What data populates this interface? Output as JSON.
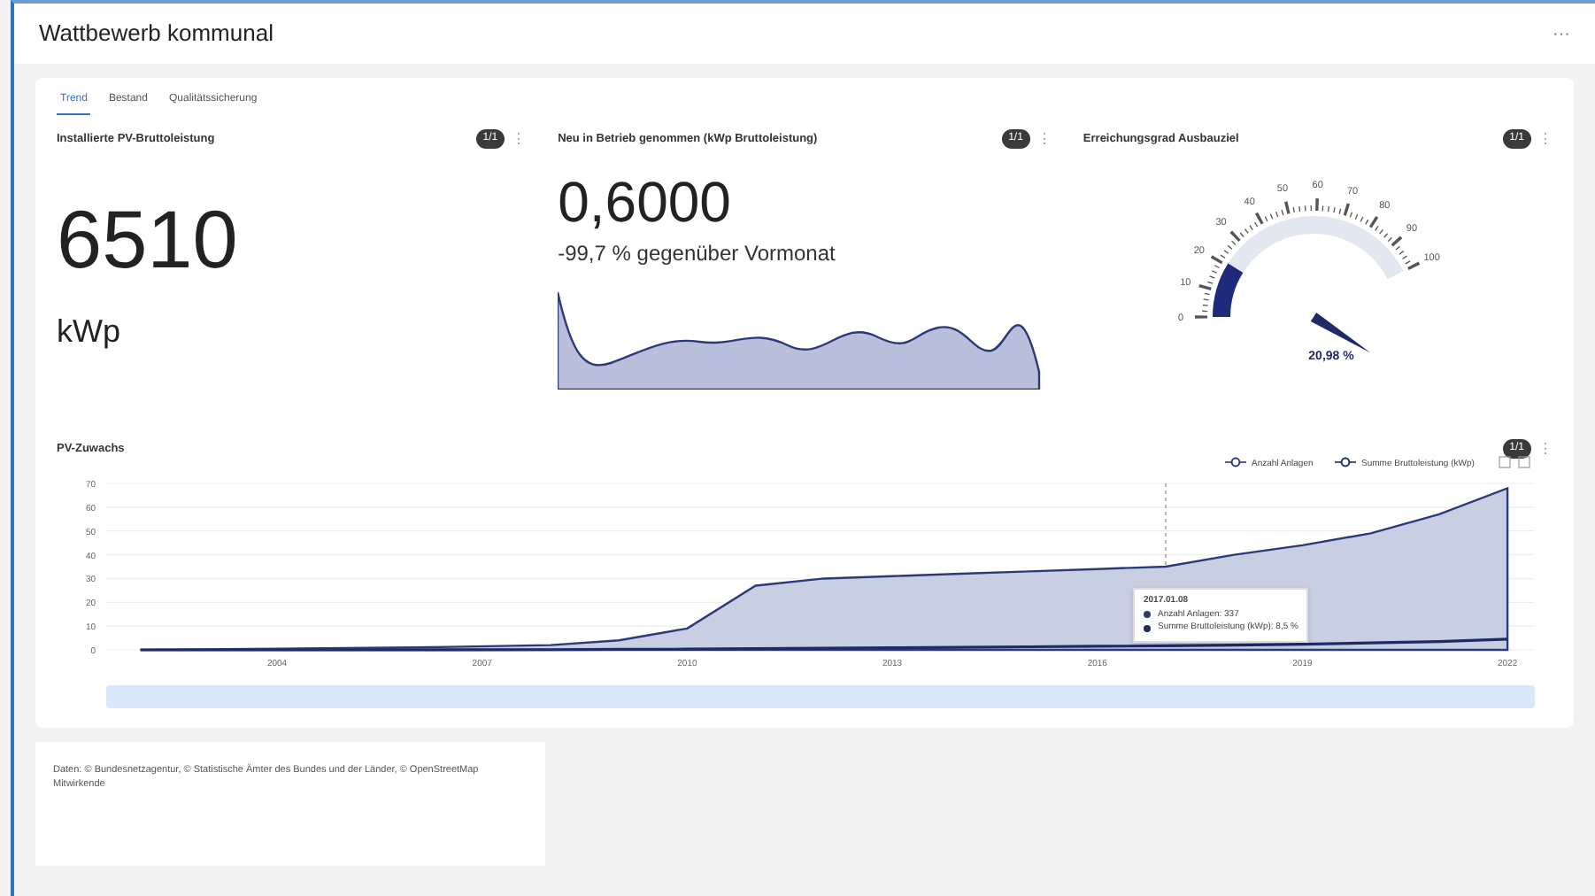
{
  "header": {
    "title": "Wattbewerb kommunal",
    "menu": "···"
  },
  "tabs": [
    {
      "label": "Trend",
      "selected": true
    },
    {
      "label": "Bestand",
      "selected": false
    },
    {
      "label": "Qualitätssicherung",
      "selected": false
    }
  ],
  "tiles": [
    {
      "kind": "number",
      "title": "Installierte PV-Bruttoleistung",
      "badge": "1/1",
      "menu": "⋮",
      "value": "6510",
      "unit": "kWp"
    },
    {
      "kind": "trend",
      "title": "Neu in Betrieb genommen (kWp Bruttoleistung)",
      "badge": "1/1",
      "menu": "⋮",
      "value": "0,6000",
      "subtitle": "-99,7 % gegenüber Vormonat"
    },
    {
      "kind": "gauge",
      "title": "Erreichungsgrad Ausbauziel",
      "badge": "1/1",
      "menu": "⋮",
      "reading": "20,98 %",
      "ticks": [
        "0",
        "10",
        "20",
        "30",
        "40",
        "50",
        "60",
        "70",
        "80",
        "90",
        "100"
      ]
    }
  ],
  "chart_panel": {
    "title": "PV-Zuwachs",
    "badge": "1/1",
    "menu": "⋮",
    "tooltip": {
      "title": "2017.01.08",
      "lines": [
        "Anzahl Anlagen: 337",
        "Summe Bruttoleistung (kWp): 8,5 %"
      ]
    },
    "chart_data": {
      "type": "area",
      "x": [
        2002,
        2004,
        2006,
        2008,
        2009,
        2010,
        2011,
        2012,
        2013,
        2014,
        2015,
        2016,
        2017,
        2018,
        2019,
        2020,
        2021,
        2022
      ],
      "series": [
        {
          "name": "Anzahl Anlagen",
          "type": "area",
          "color": "#2b3a7a",
          "values": [
            0,
            0.5,
            1,
            2,
            4,
            9,
            27,
            30,
            31,
            32,
            33,
            34,
            35,
            40,
            44,
            49,
            57,
            68
          ]
        },
        {
          "name": "Summe Bruttoleistung (kWp)",
          "type": "line",
          "color": "#1f2a66",
          "values": [
            0,
            0,
            0,
            0.1,
            0.2,
            0.3,
            0.5,
            0.7,
            0.9,
            1.1,
            1.3,
            1.5,
            1.7,
            2,
            2.4,
            2.9,
            3.5,
            4.5
          ]
        }
      ],
      "grid": true,
      "ref_lines": [
        {
          "axis": "x",
          "value": 2017
        }
      ],
      "legend": "top right",
      "xlim": [
        2001.5,
        2022.4
      ],
      "ylim": [
        0,
        70
      ],
      "xticks": [
        2004,
        2007,
        2010,
        2013,
        2016,
        2019,
        2022
      ],
      "yticks": [
        0,
        10,
        20,
        30,
        40,
        50,
        60,
        70
      ]
    }
  },
  "footer": {
    "text": "Daten: © Bundesnetzagentur, © Statistische Ämter des Bundes und der Länder, © OpenStreetMap Mitwirkende"
  }
}
